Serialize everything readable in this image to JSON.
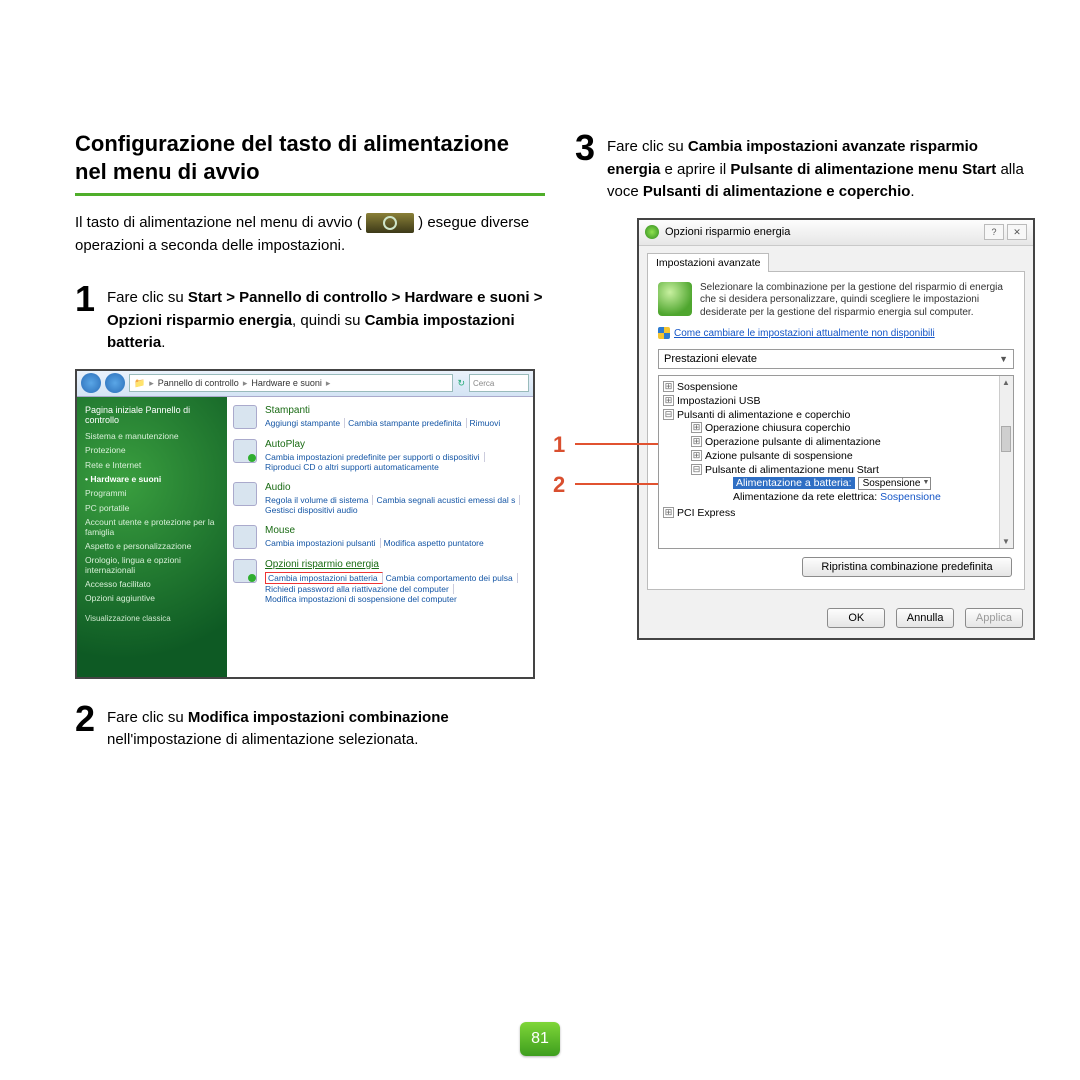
{
  "page_number": "81",
  "left": {
    "heading": "Configurazione del tasto di alimentazione nel menu di avvio",
    "intro_a": "Il tasto di alimentazione nel menu di avvio (",
    "intro_b": ") esegue diverse operazioni a seconda delle impostazioni.",
    "step1": {
      "pre": "Fare clic su ",
      "b1": "Start > Pannello di controllo > Hardware e suoni > Opzioni risparmio energia",
      "mid": ", quindi su ",
      "b2": "Cambia impostazioni batteria",
      "post": "."
    },
    "step2": {
      "pre": "Fare clic su ",
      "b1": "Modifica impostazioni combinazione",
      "post": " nell'impostazione di alimentazione selezionata."
    },
    "shot1": {
      "crumb1": "Pannello di controllo",
      "crumb2": "Hardware e suoni",
      "search_ph": "Cerca",
      "side_header": "Pagina iniziale Pannello di controllo",
      "side_items": [
        "Sistema e manutenzione",
        "Protezione",
        "Rete e Internet",
        "Hardware e suoni",
        "Programmi",
        "PC portatile",
        "Account utente e protezione per la famiglia",
        "Aspetto e personalizzazione",
        "Orologio, lingua e opzioni internazionali",
        "Accesso facilitato",
        "Opzioni aggiuntive"
      ],
      "side_footer": "Visualizzazione classica",
      "cats": {
        "printers": {
          "title": "Stampanti",
          "links": [
            "Aggiungi stampante",
            "Cambia stampante predefinita",
            "Rimuovi"
          ]
        },
        "autoplay": {
          "title": "AutoPlay",
          "links": [
            "Cambia impostazioni predefinite per supporti o dispositivi",
            "Riproduci CD o altri supporti automaticamente"
          ]
        },
        "audio": {
          "title": "Audio",
          "links": [
            "Regola il volume di sistema",
            "Cambia segnali acustici emessi dal s",
            "Gestisci dispositivi audio"
          ]
        },
        "mouse": {
          "title": "Mouse",
          "links": [
            "Cambia impostazioni pulsanti",
            "Modifica aspetto puntatore"
          ]
        },
        "power": {
          "title": "Opzioni risparmio energia",
          "links": [
            "Cambia impostazioni batteria",
            "Cambia comportamento dei pulsa",
            "Richiedi password alla riattivazione del computer",
            "Modifica impostazioni di sospensione del computer"
          ]
        }
      }
    }
  },
  "right": {
    "step3": {
      "pre": "Fare clic su ",
      "b1": "Cambia impostazioni avanzate risparmio energia",
      "mid1": " e aprire il ",
      "b2": "Pulsante di alimentazione menu Start",
      "mid2": " alla voce ",
      "b3": "Pulsanti di alimentazione e coperchio",
      "post": "."
    },
    "callout1": "1",
    "callout2": "2",
    "dlg": {
      "title": "Opzioni risparmio energia",
      "help_btn": "?",
      "close_btn": "✕",
      "tab": "Impostazioni avanzate",
      "desc": "Selezionare la combinazione per la gestione del risparmio di energia che si desidera personalizzare, quindi scegliere le impostazioni desiderate per la gestione del risparmio energia sul computer.",
      "shield_link": "Come cambiare le impostazioni attualmente non disponibili",
      "plan": "Prestazioni elevate",
      "tree": {
        "n1": "Sospensione",
        "n2": "Impostazioni USB",
        "n3": "Pulsanti di alimentazione e coperchio",
        "n3a": "Operazione chiusura coperchio",
        "n3b": "Operazione pulsante di alimentazione",
        "n3c": "Azione pulsante di sospensione",
        "n3d": "Pulsante di alimentazione menu Start",
        "n3d_sel_label": "Alimentazione a batteria:",
        "n3d_sel_val": "Sospensione",
        "n3d_ac_label": "Alimentazione da rete elettrica:",
        "n3d_ac_val": "Sospensione",
        "n4": "PCI Express"
      },
      "restore": "Ripristina combinazione predefinita",
      "ok": "OK",
      "cancel": "Annulla",
      "apply": "Applica"
    }
  }
}
